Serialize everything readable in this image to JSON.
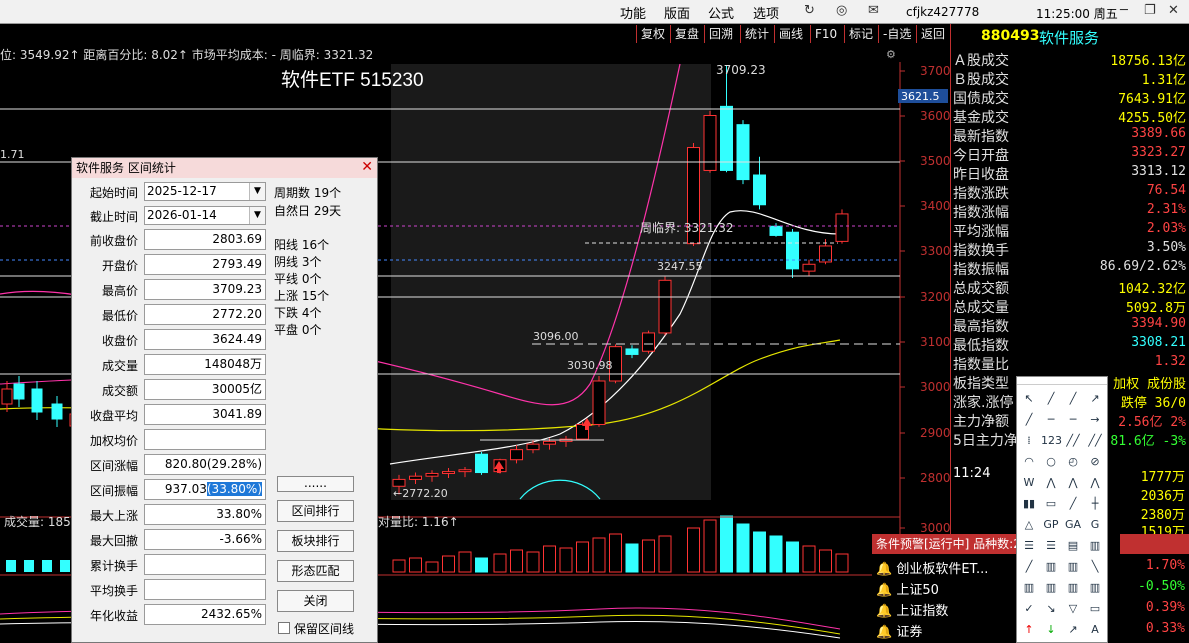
{
  "topbar": {
    "menus": [
      "功能",
      "版面",
      "公式",
      "选项"
    ],
    "user": "cfjkz427778",
    "clock": "11:25:00 周五"
  },
  "toolbar": [
    "复权",
    "复盘",
    "回溯",
    "统计",
    "画线",
    "F10",
    "标记",
    "-自选",
    "返回"
  ],
  "infobar": {
    "text": "位: 3549.92↑ 距离百分比: 8.02↑ 市场平均成本: - 周临界: 3321.32"
  },
  "chart": {
    "title": "软件ETF 515230",
    "y_ticks": [
      "3700",
      "3600",
      "3500",
      "3400",
      "3300",
      "3200",
      "3100",
      "3000",
      "2900",
      "2800",
      "30000"
    ],
    "price_tag": "3621.5",
    "annot": {
      "high": "3709.23",
      "weekly": "周临界: 3321.32",
      "p3247": "3247.55",
      "p3096": "3096.00",
      "p3030": "3030.98",
      "low": "←2772.20",
      "left_level": "1.71"
    },
    "volume_label": "成交量: 185",
    "volratio": "对量比: 1.16↑",
    "colors": {
      "up": "#ff3333",
      "down": "#33ffff",
      "ma_white": "#ffffff",
      "ma_yellow": "#e6e600",
      "ma_magenta": "#ff33aa"
    }
  },
  "chart_data": {
    "type": "candlestick",
    "title": "软件ETF 515230",
    "ylim": [
      2760,
      3730
    ],
    "candles": [
      {
        "o": 2790,
        "h": 2815,
        "l": 2772,
        "c": 2805
      },
      {
        "o": 2805,
        "h": 2820,
        "l": 2795,
        "c": 2812
      },
      {
        "o": 2812,
        "h": 2825,
        "l": 2800,
        "c": 2818
      },
      {
        "o": 2818,
        "h": 2830,
        "l": 2808,
        "c": 2822
      },
      {
        "o": 2822,
        "h": 2832,
        "l": 2810,
        "c": 2826
      },
      {
        "o": 2860,
        "h": 2865,
        "l": 2815,
        "c": 2820
      },
      {
        "o": 2822,
        "h": 2850,
        "l": 2818,
        "c": 2848
      },
      {
        "o": 2848,
        "h": 2880,
        "l": 2840,
        "c": 2870
      },
      {
        "o": 2870,
        "h": 2890,
        "l": 2862,
        "c": 2882
      },
      {
        "o": 2882,
        "h": 2895,
        "l": 2870,
        "c": 2888
      },
      {
        "o": 2888,
        "h": 2900,
        "l": 2876,
        "c": 2893
      },
      {
        "o": 2893,
        "h": 2930,
        "l": 2890,
        "c": 2925
      },
      {
        "o": 2925,
        "h": 3031,
        "l": 2920,
        "c": 3020
      },
      {
        "o": 3020,
        "h": 3100,
        "l": 3015,
        "c": 3095
      },
      {
        "o": 3090,
        "h": 3098,
        "l": 3070,
        "c": 3078
      },
      {
        "o": 3085,
        "h": 3130,
        "l": 3080,
        "c": 3125
      },
      {
        "o": 3125,
        "h": 3248,
        "l": 3120,
        "c": 3240
      },
      {
        "o": 3320,
        "h": 3540,
        "l": 3315,
        "c": 3530
      },
      {
        "o": 3480,
        "h": 3610,
        "l": 3475,
        "c": 3600
      },
      {
        "o": 3620,
        "h": 3709,
        "l": 3476,
        "c": 3480
      },
      {
        "o": 3580,
        "h": 3590,
        "l": 3450,
        "c": 3460
      },
      {
        "o": 3470,
        "h": 3510,
        "l": 3395,
        "c": 3405
      },
      {
        "o": 3358,
        "h": 3365,
        "l": 3335,
        "c": 3338
      },
      {
        "o": 3345,
        "h": 3352,
        "l": 3245,
        "c": 3265
      },
      {
        "o": 3260,
        "h": 3285,
        "l": 3250,
        "c": 3275
      },
      {
        "o": 3280,
        "h": 3330,
        "l": 3275,
        "c": 3315
      },
      {
        "o": 3325,
        "h": 3395,
        "l": 3320,
        "c": 3385
      }
    ]
  },
  "right": {
    "code": "880493",
    "name": "软件服务",
    "rows": [
      {
        "l": "Ａ股成交",
        "v": "18756.13亿",
        "c": "#ffff00"
      },
      {
        "l": "Ｂ股成交",
        "v": "1.31亿",
        "c": "#ffff00"
      },
      {
        "l": "国债成交",
        "v": "7643.91亿",
        "c": "#ffff00"
      },
      {
        "l": "基金成交",
        "v": "4255.50亿",
        "c": "#ffff00"
      },
      {
        "l": "最新指数",
        "v": "3389.66",
        "c": "#ff4444"
      },
      {
        "l": "今日开盘",
        "v": "3323.27",
        "c": "#ff4444"
      },
      {
        "l": "昨日收盘",
        "v": "3313.12",
        "c": "#e0e0e0"
      },
      {
        "l": "指数涨跌",
        "v": "76.54",
        "c": "#ff4444"
      },
      {
        "l": "指数涨幅",
        "v": "2.31%",
        "c": "#ff4444"
      },
      {
        "l": "平均涨幅",
        "v": "2.03%",
        "c": "#ff4444"
      },
      {
        "l": "指数换手",
        "v": "3.50%",
        "c": "#e0e0e0"
      },
      {
        "l": "指数振幅",
        "v": "86.69/2.62%",
        "c": "#e0e0e0"
      },
      {
        "l": "总成交额",
        "v": "1042.32亿",
        "c": "#ffff00"
      },
      {
        "l": "总成交量",
        "v": "5092.8万",
        "c": "#ffff00"
      },
      {
        "l": "最高指数",
        "v": "3394.90",
        "c": "#ff4444"
      },
      {
        "l": "最低指数",
        "v": "3308.21",
        "c": "#33ffff"
      },
      {
        "l": "指数量比",
        "v": "1.32",
        "c": "#ff4444"
      },
      {
        "l": "板指类型",
        "v": "加权 成份股",
        "c": "#ffff00"
      },
      {
        "l": "涨家.涨停",
        "v": "跌停 36/0",
        "c": "#ffff00"
      },
      {
        "l": "主力净额",
        "v": "2.56亿 2%",
        "c": "#ff4444"
      },
      {
        "l": "5日主力净",
        "v": "81.6亿 -3%",
        "c": "#33ff33"
      }
    ],
    "time": "11:24",
    "vols": [
      "1777万",
      "2036万",
      "2380万",
      "1519万"
    ]
  },
  "dialog": {
    "title": "软件服务 区间统计",
    "start_label": "起始时间",
    "start": "2025-12-17",
    "end_label": "截止时间",
    "end": "2026-01-14",
    "fields": [
      {
        "l": "前收盘价",
        "v": "2803.69"
      },
      {
        "l": "开盘价",
        "v": "2793.49"
      },
      {
        "l": "最高价",
        "v": "3709.23"
      },
      {
        "l": "最低价",
        "v": "2772.20"
      },
      {
        "l": "收盘价",
        "v": "3624.49"
      },
      {
        "l": "成交量",
        "v": "148048万"
      },
      {
        "l": "成交额",
        "v": "30005亿"
      },
      {
        "l": "收盘平均",
        "v": "3041.89"
      },
      {
        "l": "加权均价",
        "v": ""
      },
      {
        "l": "区间涨幅",
        "v": "820.80(29.28%)"
      },
      {
        "l": "区间振幅",
        "v": "937.03(33.80%)"
      },
      {
        "l": "最大上涨",
        "v": "33.80%"
      },
      {
        "l": "最大回撤",
        "v": "-3.66%"
      },
      {
        "l": "累计换手",
        "v": ""
      },
      {
        "l": "平均换手",
        "v": ""
      },
      {
        "l": "年化收益",
        "v": "2432.65%"
      }
    ],
    "stats": [
      "周期数 19个",
      "自然日 29天",
      "阳线 16个",
      "阴线 3个",
      "平线 0个",
      "上涨 15个",
      "下跌 4个",
      "平盘 0个"
    ],
    "btn_more": "......",
    "btn_rank": "区间排行",
    "btn_block": "板块排行",
    "btn_pattern": "形态匹配",
    "btn_close": "关闭",
    "keep_label": "保留区间线"
  },
  "alert": {
    "title": "条件预警[运行中] 品种数:2",
    "items": [
      {
        "name": "创业板软件ET...",
        "pct": "1.70%"
      },
      {
        "name": "上证50",
        "pct": "-0.50%"
      },
      {
        "name": "上证指数",
        "pct": "0.39%"
      },
      {
        "name": "证券",
        "pct": "0.33%"
      }
    ]
  }
}
